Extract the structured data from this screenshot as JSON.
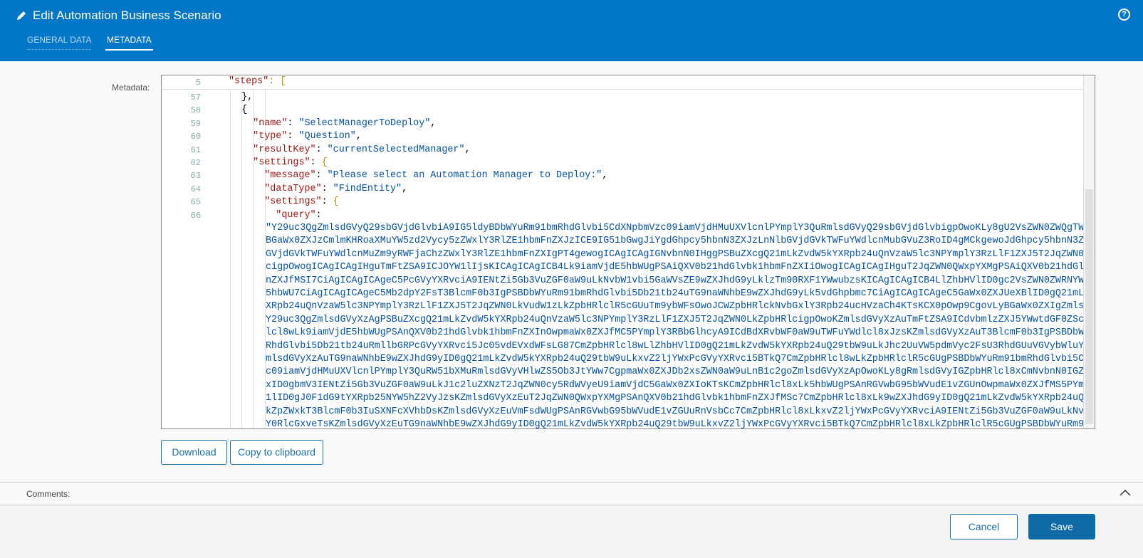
{
  "header": {
    "title": "Edit Automation Business Scenario",
    "help_icon": "?",
    "tabs": [
      {
        "label": "GENERAL DATA"
      },
      {
        "label": "METADATA"
      }
    ]
  },
  "metadata_label": "Metadata:",
  "sticky_line": {
    "num": "5",
    "key": "\"steps\"",
    "rest": ": ["
  },
  "lines": [
    {
      "num": "57",
      "indent": "  ",
      "text": "},"
    },
    {
      "num": "58",
      "indent": "  ",
      "text": "{"
    },
    {
      "num": "59",
      "indent": "    ",
      "key": "\"name\"",
      "value": "\"SelectManagerToDeploy\"",
      "end": ","
    },
    {
      "num": "60",
      "indent": "    ",
      "key": "\"type\"",
      "value": "\"Question\"",
      "end": ","
    },
    {
      "num": "61",
      "indent": "    ",
      "key": "\"resultKey\"",
      "value": "\"currentSelectedManager\"",
      "end": ","
    },
    {
      "num": "62",
      "indent": "    ",
      "key": "\"settings\"",
      "brace": "{"
    },
    {
      "num": "63",
      "indent": "      ",
      "key": "\"message\"",
      "value": "\"Please select an Automation Manager to Deploy:\"",
      "end": ","
    },
    {
      "num": "64",
      "indent": "      ",
      "key": "\"dataType\"",
      "value": "\"FindEntity\"",
      "end": ","
    },
    {
      "num": "65",
      "indent": "      ",
      "key": "\"settings\"",
      "brace": "{"
    },
    {
      "num": "66",
      "indent": "        ",
      "key": "\"query\"",
      "end": ""
    }
  ],
  "query_lines": [
    "\"Y29uc3QgZmlsdGVyQ29sbGVjdGlvbiA9IG5ldyBDbWYuRm91bmRhdGlvbi5CdXNpbmVzc09iamVjdHMuUXVlcnlPYmplY3QuRmlsdGVyQ29sbGVjdGlvbigpOwoKLy8gU2VsZWN0ZWQgTWFuYWdlci",
    "BGaWx0ZXJzCmlmKHRoaXMuYW5zd2Vycy5zZWxlY3RlZE1hbmFnZXJzICE9IG51bGwgJiYgdGhpcy5hbnN3ZXJzLnNlbGVjdGVkTWFuYWdlcnMubGVuZ3RoID4gMCkgewoJdGhpcy5hbnN3ZXJzLnNlb",
    "GVjdGVkTWFuYWdlcnMuZm9yRWFjaChzZWxlY3RlZE1hbmFnZXIgPT4gewogICAgICAgIGNvbnN0IHggPSBuZXcgQ21mLkZvdW5kYXRpb24uQnVzaW5lc3NPYmplY3RzLlF1ZXJ5T2JqZWN0LkZpbHRl",
    "cigpOwogICAgICAgIHguTmFtZSA9ICJOYW1lIjsKICAgICAgICB4Lk9iamVjdE5hbWUgPSAiQXV0b21hdGlvbk1hbmFnZXIiOwogICAgICAgIHguT2JqZWN0QWxpYXMgPSAiQXV0b21hdGlvbk1hbmF",
    "nZXJfMSI7CiAgICAgICAgeC5PcGVyYXRvciA9IENtZi5Gb3VuZGF0aW9uLkNvbW1vbi5GaWVsZE9wZXJhdG9yLklzTm90RXF1YWwubzsKICAgICAgICB4LlZhbHVlID0gc2VsZWN0ZWRNYW5hZ2VyLk",
    "5hbWU7CiAgICAgICAgeC5Mb2dpY2FsT3BlcmF0b3IgPSBDbWYuRm91bmRhdGlvbi5Db21tb24uTG9naWNhbE9wZXJhdG9yLk5vdGhpbmc7CiAgICAgICAgeC5GaWx0ZXJUeXBlID0gQ21mLkZvdW5kYX",
    "XRpb24uQnVzaW5lc3NPYmplY3RzLlF1ZXJ5T2JqZWN0LkVudW1zLkZpbHRlclR5cGUuTm9ybWFsOwoJCWZpbHRlckNvbGxlY3Rpb24ucHVzaCh4KTsKCX0pOwp9CgovLyBGaWx0ZXIgZmlsdGVyXzAK",
    "Y29uc3QgZmlsdGVyXzAgPSBuZXcgQ21mLkZvdW5kYXRpb24uQnVzaW5lc3NPYmplY3RzLlF1ZXJ5T2JqZWN0LkZpbHRlcigpOwoKZmlsdGVyXzAuTmFtZSA9ICdvbmlzZXJ5YWwtdGF0ZSc7CmZpbHRlcHR",
    "lcl8wLk9iamVjdE5hbWUgPSAnQXV0b21hdGlvbk1hbmFnZXInOwpmaWx0ZXJfMC5PYmplY3RBbGlhcyA9ICdBdXRvbWF0aW9uTWFuYWdlcl8xJzsKZmlsdGVyXzAuT3BlcmF0b3IgPSBDbWYuRm91bm",
    "RhdGlvbi5Db21tb24uRmllbGRPcGVyYXRvci5Jc05vdEVxdWFsLG87CmZpbHRlcl8wLlZhbHVlID0gQ21mLkZvdW5kYXRpb24uQ29tbW9uLkJhc2UuVW5pdmVyc2FsU3RhdGUuVGVybWluYXRlZDsKZ",
    "mlsdGVyXzAuTG9naWNhbE9wZXJhdG9yID0gQ21mLkZvdW5kYXRpb24uQ29tbW9uLkxvZ2ljYWxPcGVyYXRvci5BTkQ7CmZpbHRlcl8wLkZpbHRlclR5cGUgPSBDbWYuRm91bmRhdGlvbi5CdXNpbmVzcz",
    "c09iamVjdHMuUXVlcnlPYmplY3QuRW51bXMuRmlsdGVyVHlwZS5Ob3JtYWw7CgpmaWx0ZXJDb2xsZWN0aW9uLnB1c2goZmlsdGVyXzApOwoKLy8gRmlsdGVyIGZpbHRlcl8xCmNvbnN0IGZpbHRlcl8",
    "xID0gbmV3IENtZi5Gb3VuZGF0aW9uLkJ1c2luZXNzT2JqZWN0cy5RdWVyeU9iamVjdC5GaWx0ZXIoKTsKCmZpbHRlcl8xLk5hbWUgPSAnRGVwbG95bWVudE1vZGUnOwpmaWx0ZXJfMS5PYmplY3ROYW",
    "1lID0gJ0F1dG9tYXRpb25NYW5hZ2VyJzsKZmlsdGVyXzEuT2JqZWN0QWxpYXMgPSAnQXV0b21hdGlvbk1hbmFnZXJfMSc7CmZpbHRlcl8xLk9wZXJhdG9yID0gQ21mLkZvdW5kYXRpb24uQ29tbW9uL",
    "kZpZWxkT3BlcmF0b3IuSXNFcXVhbDsKZmlsdGVyXzEuVmFsdWUgPSAnRGVwbG95bWVudE1vZGUuRnVsbCc7CmZpbHRlcl8xLkxvZ2ljYWxPcGVyYXRvciA9IENtZi5Gb3VuZGF0aW9uLkNvbW1vbi5BTkQ7",
    "Y0RlcGxveTsKZmlsdGVyXzEuTG9naWNhbE9wZXJhdG9yID0gQ21mLkZvdW5kYXRpb24uQ29tbW9uLkxvZ2ljYWxPcGVyYXRvci5BTkQ7CmZpbHRlcl8xLkZpbHRlclR5cGUgPSBDbWYuRm91bmRhdGl"
  ],
  "buttons": {
    "download": "Download",
    "copy": "Copy to clipboard",
    "cancel": "Cancel",
    "save": "Save"
  },
  "comments_label": "Comments:",
  "colors": {
    "header": "#0277c8",
    "save": "#0f6aa6"
  }
}
